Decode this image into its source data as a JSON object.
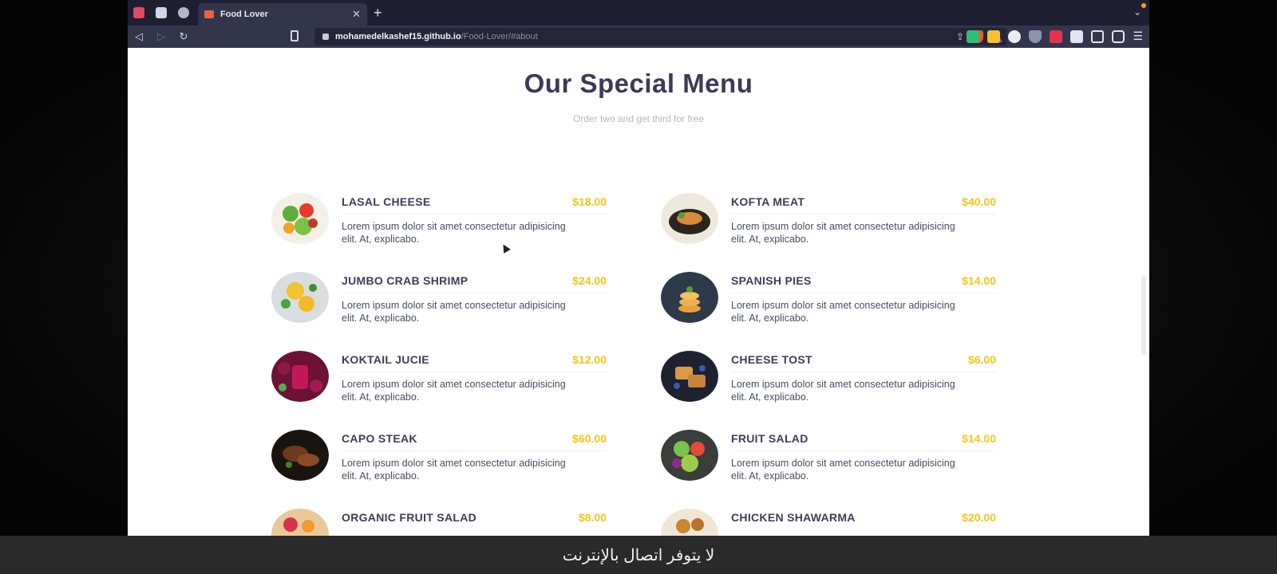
{
  "browser": {
    "tab": {
      "title": "Food Lover"
    },
    "url": {
      "host": "mohamedelkashef15.github.io",
      "path": "/Food-Lover/#about"
    }
  },
  "menu_section": {
    "title": "Our Special Menu",
    "subtitle": "Order two and get third for free",
    "items": [
      {
        "name": "LASAL CHEESE",
        "price": "$18.00",
        "desc": "Lorem ipsum dolor sit amet consectetur adipisicing elit. At, explicabo."
      },
      {
        "name": "KOFTA MEAT",
        "price": "$40.00",
        "desc": "Lorem ipsum dolor sit amet consectetur adipisicing elit. At, explicabo."
      },
      {
        "name": "JUMBO CRAB SHRIMP",
        "price": "$24.00",
        "desc": "Lorem ipsum dolor sit amet consectetur adipisicing elit. At, explicabo."
      },
      {
        "name": "SPANISH PIES",
        "price": "$14.00",
        "desc": "Lorem ipsum dolor sit amet consectetur adipisicing elit. At, explicabo."
      },
      {
        "name": "KOKTAIL JUCIE",
        "price": "$12.00",
        "desc": "Lorem ipsum dolor sit amet consectetur adipisicing elit. At, explicabo."
      },
      {
        "name": "CHEESE TOST",
        "price": "$6.00",
        "desc": "Lorem ipsum dolor sit amet consectetur adipisicing elit. At, explicabo."
      },
      {
        "name": "CAPO STEAK",
        "price": "$60.00",
        "desc": "Lorem ipsum dolor sit amet consectetur adipisicing elit. At, explicabo."
      },
      {
        "name": "FRUIT SALAD",
        "price": "$14.00",
        "desc": "Lorem ipsum dolor sit amet consectetur adipisicing elit. At, explicabo."
      },
      {
        "name": "ORGANIC FRUIT SALAD",
        "price": "$8.00",
        "desc": ""
      },
      {
        "name": "CHICKEN SHAWARMA",
        "price": "$20.00",
        "desc": ""
      }
    ]
  },
  "caption": {
    "text": "لا يتوفر اتصال بالإنترنت"
  },
  "colors": {
    "price": "#f7c51a",
    "heading": "#3a3c56",
    "browser_chrome": "#33354d"
  },
  "icons": [
    "calendar-icon",
    "document-icon",
    "globe-icon",
    "back-icon",
    "forward-icon",
    "reload-icon",
    "bookmark-icon",
    "lock-icon",
    "share-icon",
    "brave-shield-icon",
    "bat-icon",
    "extensions-icon",
    "menu-icon"
  ]
}
